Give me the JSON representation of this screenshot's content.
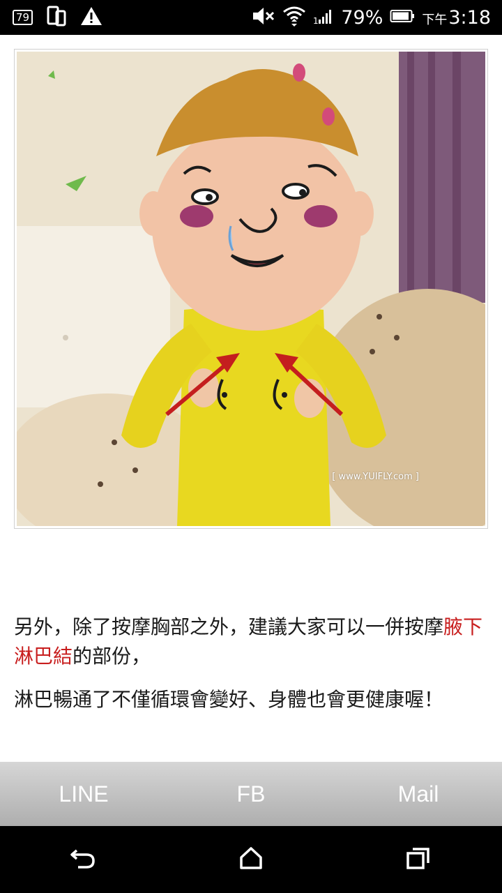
{
  "status_bar": {
    "badge": "79",
    "battery_percent": "79%",
    "time_prefix": "下午",
    "time": "3:18",
    "icons": [
      "notification-badge-icon",
      "screen-rotate-icon",
      "warning-icon",
      "mute-icon",
      "wifi-icon",
      "signal-icon",
      "battery-icon"
    ]
  },
  "photo": {
    "watermark": "[ www.YUIFLY.com ]",
    "arrow_color": "#c41e1e"
  },
  "article": {
    "p1_text": "另外，除了按摩胸部之外，建議大家可以一併按摩",
    "p1_highlight": "腋下淋巴結",
    "p1_tail": "的部份，",
    "p2_text": "淋巴暢通了不僅循環會變好、身體也會更健康喔！",
    "highlight_color": "#c81e1e"
  },
  "share_bar": {
    "line": "LINE",
    "fb": "FB",
    "mail": "Mail"
  },
  "nav_bar": {
    "icons": [
      "back-icon",
      "home-icon",
      "recents-icon"
    ]
  }
}
